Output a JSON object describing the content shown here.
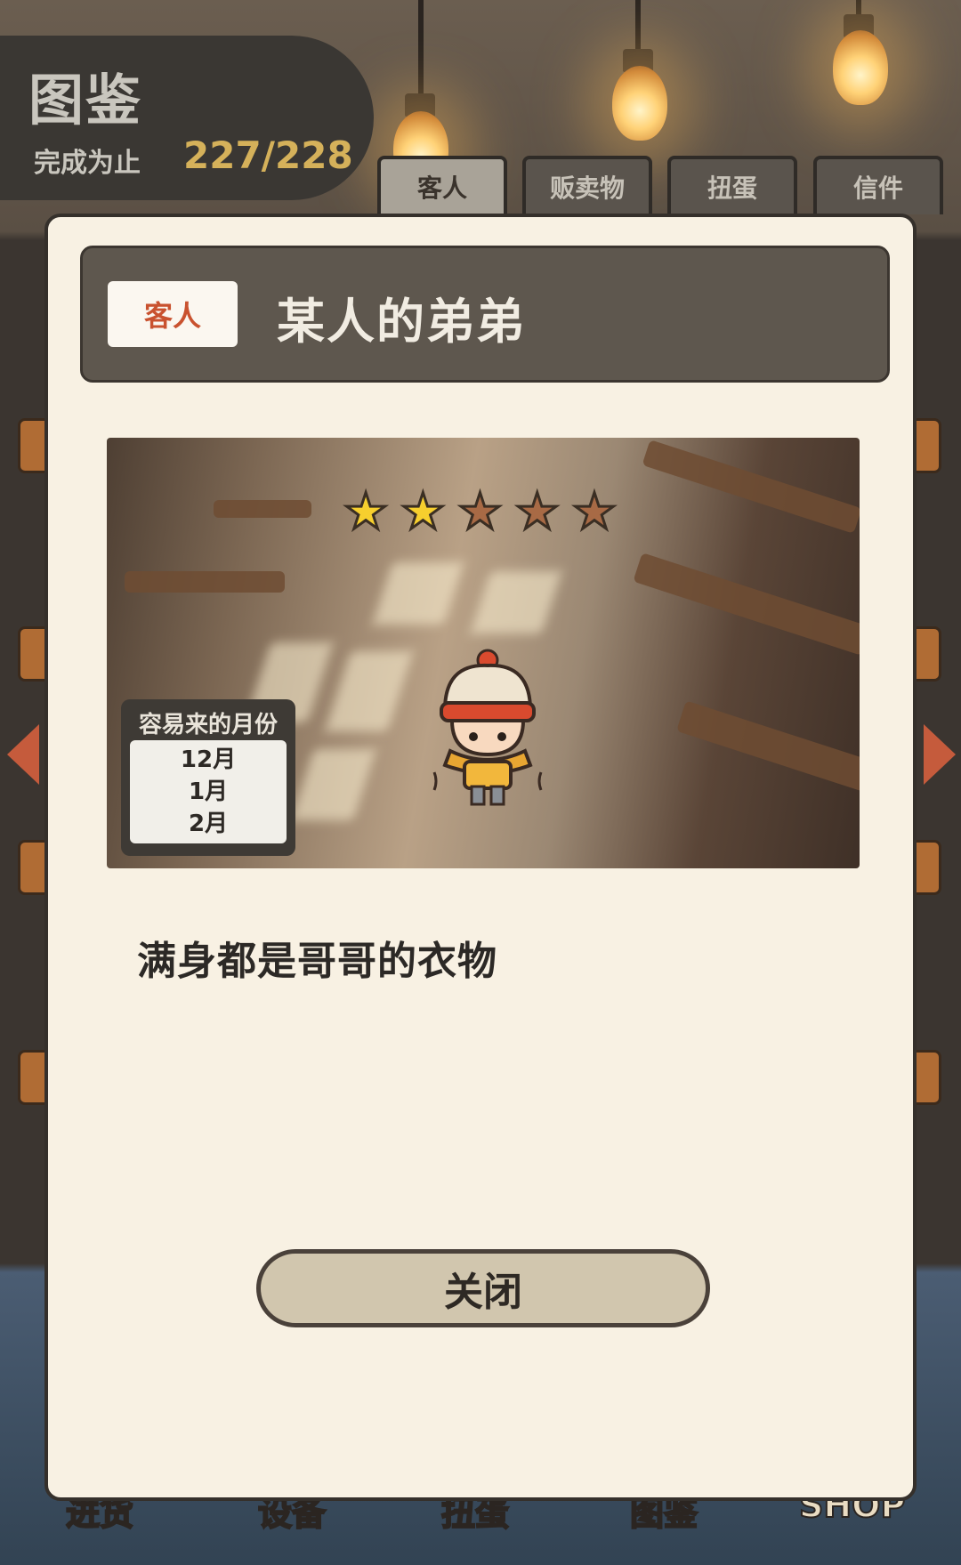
{
  "header": {
    "title": "图鉴",
    "progress_label": "完成为止",
    "progress_value": "227/228"
  },
  "tabs": [
    {
      "label": "客人",
      "active": true
    },
    {
      "label": "贩卖物",
      "active": false
    },
    {
      "label": "扭蛋",
      "active": false
    },
    {
      "label": "信件",
      "active": false
    }
  ],
  "bottom_nav": [
    "进货",
    "设备",
    "扭蛋",
    "图鉴",
    "SHOP"
  ],
  "modal": {
    "category_badge": "客人",
    "item_name": "某人的弟弟",
    "rating": {
      "filled": 2,
      "total": 5
    },
    "season": {
      "title": "容易来的月份",
      "months": [
        "12月",
        "1月",
        "2月"
      ]
    },
    "description": "满身都是哥哥的衣物",
    "close_label": "关闭"
  },
  "colors": {
    "accent_red": "#c9522f",
    "progress_gold": "#d5b15a",
    "star_filled": "#f7cf2e",
    "star_empty": "#a86a45",
    "modal_bg": "#f8f1e3"
  }
}
